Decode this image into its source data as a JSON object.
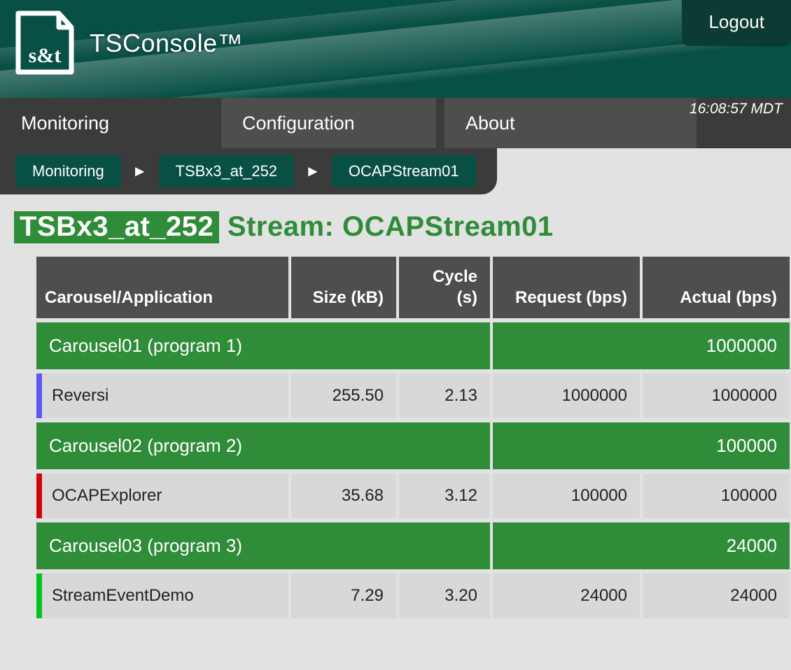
{
  "header": {
    "app_title": "TSConsole™",
    "logo_text": "s&t",
    "logout_label": "Logout"
  },
  "nav": {
    "items": [
      {
        "label": "Monitoring"
      },
      {
        "label": "Configuration"
      },
      {
        "label": "About"
      }
    ],
    "clock": "16:08:57 MDT"
  },
  "breadcrumb": {
    "items": [
      "Monitoring",
      "TSBx3_at_252",
      "OCAPStream01"
    ],
    "separator": "►"
  },
  "page_title": {
    "highlight": "TSBx3_at_252",
    "after_text": "Stream: OCAPStream01"
  },
  "table": {
    "headers": {
      "app": "Carousel/Application",
      "size": "Size (kB)",
      "cycle": "Cycle (s)",
      "req": "Request (bps)",
      "act": "Actual (bps)"
    },
    "groups": [
      {
        "name": "Carousel01 (program 1)",
        "actual": "1000000",
        "rows": [
          {
            "stripe": "blue",
            "app": "Reversi",
            "size": "255.50",
            "cycle": "2.13",
            "req": "1000000",
            "act": "1000000"
          }
        ]
      },
      {
        "name": "Carousel02 (program 2)",
        "actual": "100000",
        "rows": [
          {
            "stripe": "red",
            "app": "OCAPExplorer",
            "size": "35.68",
            "cycle": "3.12",
            "req": "100000",
            "act": "100000"
          }
        ]
      },
      {
        "name": "Carousel03 (program 3)",
        "actual": "24000",
        "rows": [
          {
            "stripe": "green",
            "app": "StreamEventDemo",
            "size": "7.29",
            "cycle": "3.20",
            "req": "24000",
            "act": "24000"
          }
        ]
      }
    ]
  }
}
